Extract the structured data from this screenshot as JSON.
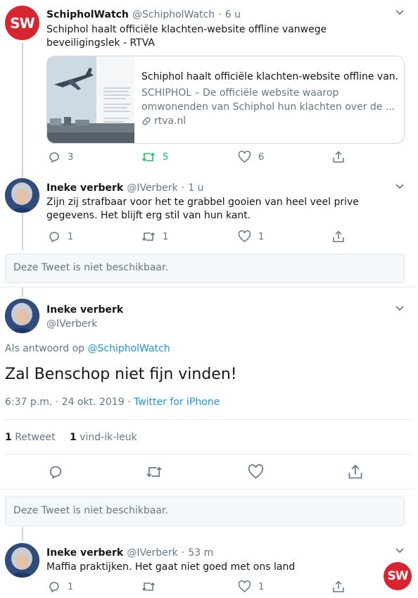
{
  "tweet1": {
    "name": "SchipholWatch",
    "handle": "@SchipholWatch",
    "time": "6 u",
    "text": "Schiphol haalt officiële klachten-website offline vanwege beveiligingslek - RTVA",
    "avatar_text": "SW",
    "card": {
      "title": "Schiphol haalt officiële klachten-website offline van...",
      "description": "SCHIPHOL – De officiële website waarop omwonenden van Schiphol hun klachten over de ...",
      "domain": "rtva.nl"
    },
    "replies": "3",
    "retweets": "5",
    "likes": "6"
  },
  "tweet2": {
    "name": "Ineke verberk",
    "handle": "@IVerberk",
    "time": "1 u",
    "text": "Zijn zij strafbaar voor het te grabbel gooien van heel veel prive gegevens. Het blijft erg stil van hun kant.",
    "replies": "1",
    "retweets": "1",
    "likes": "1"
  },
  "unavailable1": "Deze Tweet is niet beschikbaar.",
  "main_tweet": {
    "name": "Ineke verberk",
    "handle": "@IVerberk",
    "reply_prefix": "Als antwoord op",
    "reply_to": "@SchipholWatch",
    "text": "Zal Benschop niet fijn vinden!",
    "timestamp": "6:37 p.m. · 24 okt. 2019 ·",
    "source": "Twitter for iPhone",
    "retweet_count": "1",
    "retweet_label": "Retweet",
    "like_count": "1",
    "like_label": "vind-ik-leuk"
  },
  "unavailable2": "Deze Tweet is niet beschikbaar.",
  "tweet3": {
    "name": "Ineke verberk",
    "handle": "@IVerberk",
    "time": "53 m",
    "text": "Maffia praktijken. Het gaat niet goed met ons land",
    "replies": "1",
    "likes": "1"
  },
  "floating_logo": "SW",
  "colors": {
    "brand_red": "#d9232e",
    "retweet_green": "#17bf63",
    "link_blue": "#1b95e0",
    "muted": "#657786"
  }
}
